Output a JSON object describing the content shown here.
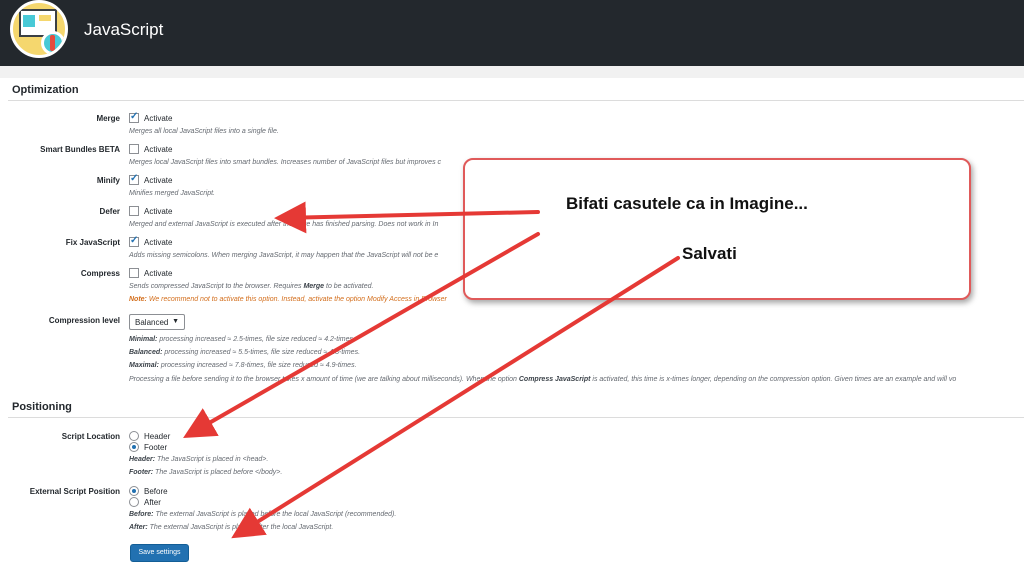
{
  "header": {
    "title": "JavaScript"
  },
  "optimization": {
    "title": "Optimization",
    "merge": {
      "label": "Merge",
      "option": "Activate",
      "checked": true,
      "desc": "Merges all local JavaScript files into a single file."
    },
    "smart_bundles": {
      "label": "Smart Bundles BETA",
      "option": "Activate",
      "checked": false,
      "desc": "Merges local JavaScript files into smart bundles. Increases number of JavaScript files but improves c"
    },
    "minify": {
      "label": "Minify",
      "option": "Activate",
      "checked": true,
      "desc": "Minifies merged JavaScript."
    },
    "defer": {
      "label": "Defer",
      "option": "Activate",
      "checked": false,
      "desc": "Merged and external JavaScript is executed after the page has finished parsing. Does not work in In"
    },
    "fix_js": {
      "label": "Fix JavaScript",
      "option": "Activate",
      "checked": true,
      "desc": "Adds missing semicolons. When merging JavaScript, it may happen that the JavaScript will not be e"
    },
    "compress": {
      "label": "Compress",
      "option": "Activate",
      "checked": false,
      "desc_prefix": "Sends compressed JavaScript to the browser. Requires ",
      "desc_bold": "Merge",
      "desc_suffix": " to be activated.",
      "note_label": "Note:",
      "note_text": " We recommend not to activate this option. Instead, activate the option Modify Access in Browser"
    },
    "compression_level": {
      "label": "Compression level",
      "selected": "Balanced",
      "minimal_label": "Minimal:",
      "minimal_text": " processing increased ≈ 2.5-times, file size reduced ≈ 4.2-times.",
      "balanced_label": "Balanced:",
      "balanced_text": " processing increased ≈ 5.5-times, file size reduced ≈ 4.8-times.",
      "maximal_label": "Maximal:",
      "maximal_text": " processing increased ≈ 7.8-times, file size reduced ≈ 4.9-times.",
      "processing_prefix": "Processing a file before sending it to the browser takes x amount of time (we are talking about milliseconds). When the option ",
      "processing_bold": "Compress JavaScript",
      "processing_suffix": " is activated, this time is x-times longer, depending on the compression option. Given times are an example and will vo"
    }
  },
  "positioning": {
    "title": "Positioning",
    "script_location": {
      "label": "Script Location",
      "options": [
        "Header",
        "Footer"
      ],
      "selected": "Footer",
      "header_label": "Header:",
      "header_text": " The JavaScript is placed in <head>.",
      "footer_label": "Footer:",
      "footer_text": " The JavaScript is placed before </body>."
    },
    "external_position": {
      "label": "External Script Position",
      "options": [
        "Before",
        "After"
      ],
      "selected": "Before",
      "before_label": "Before:",
      "before_text": " The external JavaScript is placed before the local JavaScript (recommended).",
      "after_label": "After:",
      "after_text": " The external JavaScript is placed after the local JavaScript."
    }
  },
  "save_label": "Save settings",
  "callout": {
    "line1": "Bifati casutele ca in Imagine...",
    "line2": "Salvati"
  },
  "colors": {
    "accent": "#2271b1",
    "header_bg": "#23282d",
    "arrow": "#e53935",
    "note": "#d36e1c"
  }
}
